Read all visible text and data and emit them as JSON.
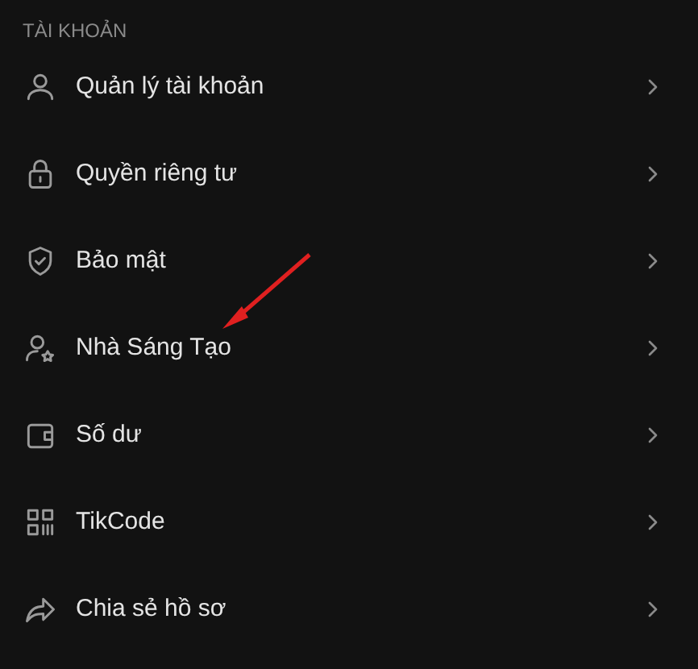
{
  "section_title": "TÀI KHOẢN",
  "items": [
    {
      "label": "Quản lý tài khoản"
    },
    {
      "label": "Quyền riêng tư"
    },
    {
      "label": "Bảo mật"
    },
    {
      "label": "Nhà Sáng Tạo"
    },
    {
      "label": "Số dư"
    },
    {
      "label": "TikCode"
    },
    {
      "label": "Chia sẻ hồ sơ"
    }
  ]
}
